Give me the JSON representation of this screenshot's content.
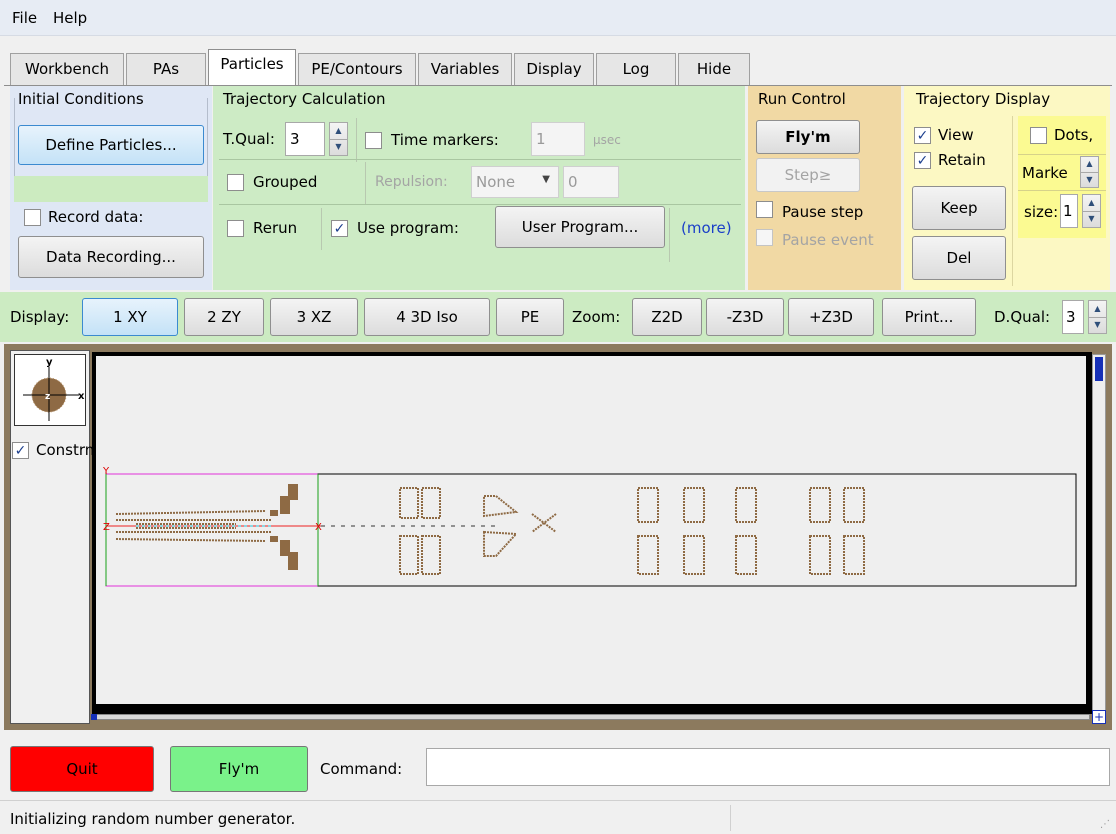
{
  "menu": [
    "File",
    "Help"
  ],
  "tabs": [
    "Workbench",
    "PAs",
    "Particles",
    "PE/Contours",
    "Variables",
    "Display",
    "Log",
    "Hide"
  ],
  "groups": {
    "initial": "Initial Conditions",
    "trajectory": "Trajectory Calculation",
    "run": "Run Control",
    "display": "Trajectory Display"
  },
  "initial": {
    "define": "Define Particles...",
    "record_label": "Record data:",
    "data_recording": "Data Recording..."
  },
  "traj": {
    "tqual_label": "T.Qual:",
    "tqual_value": "3",
    "time_markers_label": "Time markers:",
    "time_markers_value": "1",
    "time_unit": "µsec",
    "grouped": "Grouped",
    "repulsion_label": "Repulsion:",
    "repulsion_value": "None",
    "repulsion_amount": "0",
    "rerun": "Rerun",
    "use_program": "Use program:",
    "user_program": "User Program...",
    "more": "(more)"
  },
  "run": {
    "flym": "Fly'm",
    "step": "Step≥",
    "pause_step": "Pause step",
    "pause_event": "Pause event"
  },
  "tdisplay": {
    "view": "View",
    "retain": "Retain",
    "keep": "Keep",
    "del": "Del",
    "dots": "Dots,",
    "marker": "Marke",
    "size_label": "size:",
    "size_value": "1"
  },
  "toolbar": {
    "display_label": "Display:",
    "views": [
      "1 XY",
      "2 ZY",
      "3 XZ",
      "4 3D Iso",
      "PE"
    ],
    "zoom_label": "Zoom:",
    "zooms": [
      "Z2D",
      "-Z3D",
      "+Z3D"
    ],
    "print": "Print...",
    "dqual_label": "D.Qual:",
    "dqual_value": "3"
  },
  "view": {
    "constrn": "Constrn",
    "axis_y": "y",
    "axis_x": "x",
    "axis_z": "z"
  },
  "bottom": {
    "quit": "Quit",
    "flym": "Fly'm",
    "command_label": "Command:",
    "command_value": ""
  },
  "status": {
    "text": "Initializing random number generator."
  },
  "colors": {
    "initial_bg": "#dfe7f5",
    "traj_bg": "#cdebc5",
    "run_bg": "#f1d9a4",
    "display_bg": "#fcf8c3",
    "view_frame": "#8c7a5e",
    "electrode": "#8e6a44",
    "quit": "#ff0000",
    "flym_green": "#7af28a"
  }
}
